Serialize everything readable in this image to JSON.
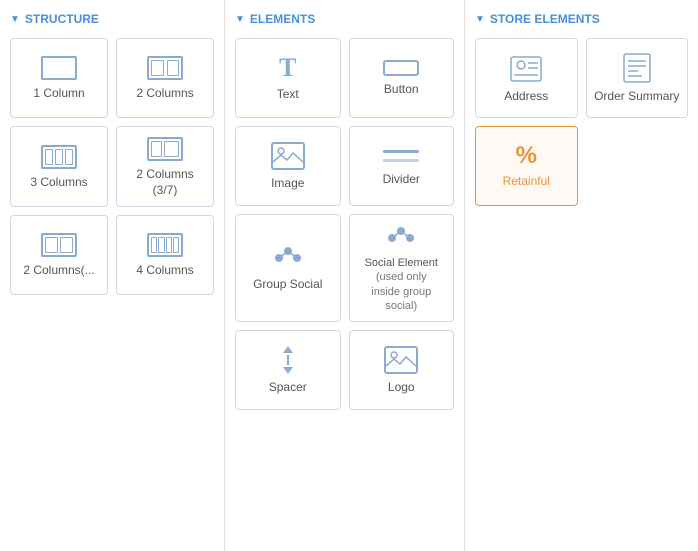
{
  "structure": {
    "title": "STRUCTURE",
    "items": [
      {
        "id": "1col",
        "label": "1 Column"
      },
      {
        "id": "2col",
        "label": "2 Columns"
      },
      {
        "id": "3col",
        "label": "3 Columns"
      },
      {
        "id": "2col37",
        "label": "2 Columns (3/7)"
      },
      {
        "id": "2col-left",
        "label": "2 Columns(..."
      },
      {
        "id": "4col",
        "label": "4 Columns"
      }
    ]
  },
  "elements": {
    "title": "ELEMENTS",
    "items": [
      {
        "id": "text",
        "label": "Text"
      },
      {
        "id": "button",
        "label": "Button"
      },
      {
        "id": "image",
        "label": "Image"
      },
      {
        "id": "divider",
        "label": "Divider"
      },
      {
        "id": "group-social",
        "label": "Group Social"
      },
      {
        "id": "social-element",
        "label": "Social Element\n(used only\ninside group\nsocial)"
      },
      {
        "id": "spacer",
        "label": "Spacer"
      },
      {
        "id": "logo",
        "label": "Logo"
      }
    ]
  },
  "store": {
    "title": "STORE ELEMENTS",
    "items": [
      {
        "id": "address",
        "label": "Address"
      },
      {
        "id": "order-summary",
        "label": "Order Summary"
      },
      {
        "id": "retainful",
        "label": "Retainful",
        "special": true
      }
    ]
  }
}
